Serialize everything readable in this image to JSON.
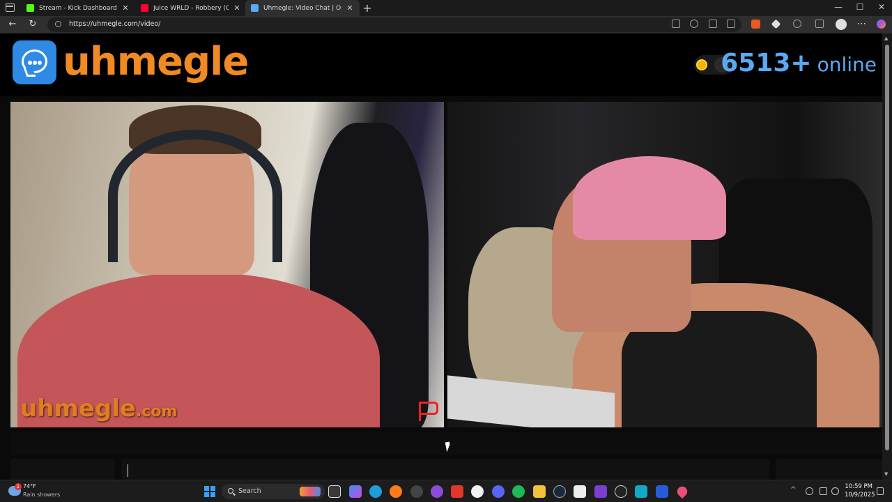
{
  "browser": {
    "tabs": [
      {
        "title": "Stream - Kick Dashboard",
        "favicon_color": "#53fc18",
        "active": false
      },
      {
        "title": "Juice WRLD - Robbery (Official M",
        "favicon_color": "#ff0033",
        "active": false
      },
      {
        "title": "Uhmegle: Video Chat | Ome",
        "favicon_color": "#5aa9f2",
        "active": true
      }
    ],
    "tab_close_glyph": "✕",
    "new_tab_glyph": "+",
    "window_controls": {
      "minimize": "—",
      "maximize": "☐",
      "close": "✕"
    },
    "nav": {
      "back": "←",
      "reload": "↻"
    },
    "url": "https://uhmegle.com/video/",
    "more_menu_glyph": "⋯"
  },
  "site": {
    "logo_text": "uhmegle",
    "brand_color": "#f08a24",
    "accent_color": "#5aa9f2",
    "online_count": "6513+",
    "online_label": "online",
    "watermark_main": "uhmegle",
    "watermark_suffix": ".com"
  },
  "taskbar": {
    "weather_badge": "1",
    "weather_temp": "74°F",
    "weather_desc": "Rain showers",
    "search_label": "Search",
    "tray_up_glyph": "^",
    "time": "10:59 PM",
    "date": "10/9/2025"
  }
}
